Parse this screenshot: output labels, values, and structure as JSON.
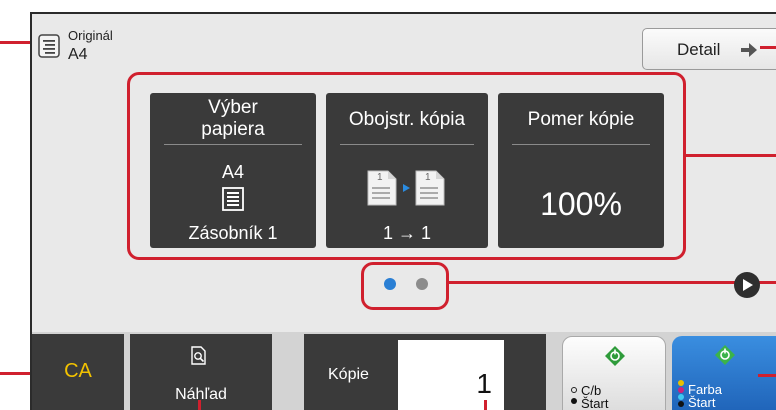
{
  "original": {
    "label": "Originál",
    "value": "A4"
  },
  "detail_button": {
    "label": "Detail"
  },
  "tiles": {
    "paper": {
      "title_line1": "Výber",
      "title_line2": "papiera",
      "size": "A4",
      "tray": "Zásobník 1"
    },
    "duplex": {
      "title": "Obojstr. kópia",
      "page_left": "1",
      "page_right": "1",
      "mode": "1 → 1"
    },
    "ratio": {
      "title": "Pomer kópie",
      "value": "100%"
    }
  },
  "pager": {
    "pages": 2,
    "active": 1
  },
  "bottom": {
    "ca_label": "CA",
    "preview_label": "Náhľad",
    "copies_label": "Kópie",
    "copies_value": "1",
    "bw_start_line1": "C/b",
    "bw_start_line2": "Štart",
    "color_start_line1": "Farba",
    "color_start_line2": "Štart"
  },
  "colors": {
    "accent_red": "#d0202e",
    "tile_dark": "#3a3a3a",
    "color_start_blue": "#1f6fc4",
    "start_green": "#2e9b3a"
  }
}
